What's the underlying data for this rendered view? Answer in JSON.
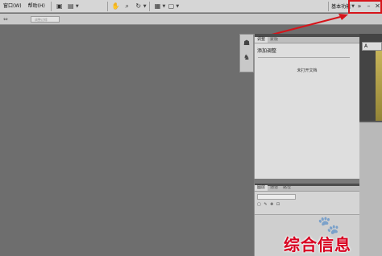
{
  "menubar": {
    "window_label": "窗口(W)",
    "help_label": "帮助(H)",
    "workspace_label": "基本功能",
    "min_symbol": "–",
    "close_symbol": "✕"
  },
  "options_bar": {
    "field_placeholder": "调整边缘"
  },
  "panel": {
    "tabs": [
      "调整",
      "蒙版"
    ],
    "heading": "添加调整",
    "message": "未打开文档"
  },
  "panel2": {
    "tabs": [
      "图层",
      "通道",
      "路径"
    ]
  },
  "right_dock": {
    "tab_label": "A"
  },
  "watermark": {
    "text": "综合信息"
  },
  "colors": {
    "highlight": "#d6141a",
    "watermark": "#d8001f"
  }
}
